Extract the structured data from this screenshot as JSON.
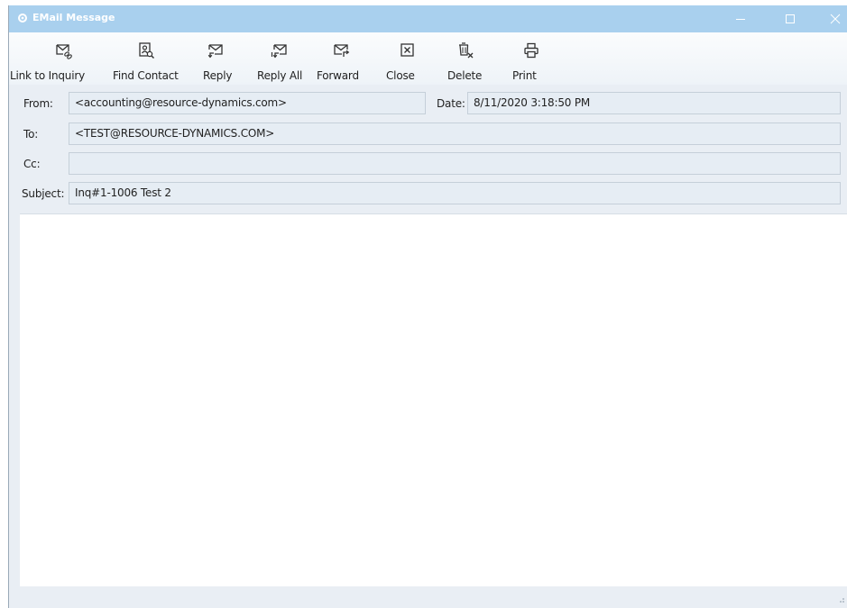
{
  "window": {
    "title": "EMail Message",
    "app_icon": "gear-icon"
  },
  "title_controls": {
    "minimize": "minimize-icon",
    "maximize": "maximize-icon",
    "close": "close-icon"
  },
  "toolbar": {
    "link_to_inquiry": "Link to Inquiry",
    "find_contact": "Find Contact",
    "reply": "Reply",
    "reply_all": "Reply All",
    "forward": "Forward",
    "close": "Close",
    "delete": "Delete",
    "print": "Print"
  },
  "header": {
    "from_label": "From:",
    "from_value": "<accounting@resource-dynamics.com>",
    "date_label": "Date:",
    "date_value": "8/11/2020 3:18:50 PM",
    "to_label": "To:",
    "to_value": "<TEST@RESOURCE-DYNAMICS.COM>",
    "cc_label": "Cc:",
    "cc_value": "",
    "subject_label": "Subject:",
    "subject_value": "Inq#1-1006 Test 2"
  },
  "colors": {
    "titlebar": "#a9d0ee",
    "window_bg": "#e9eef4",
    "field_bg": "#e6edf4"
  }
}
